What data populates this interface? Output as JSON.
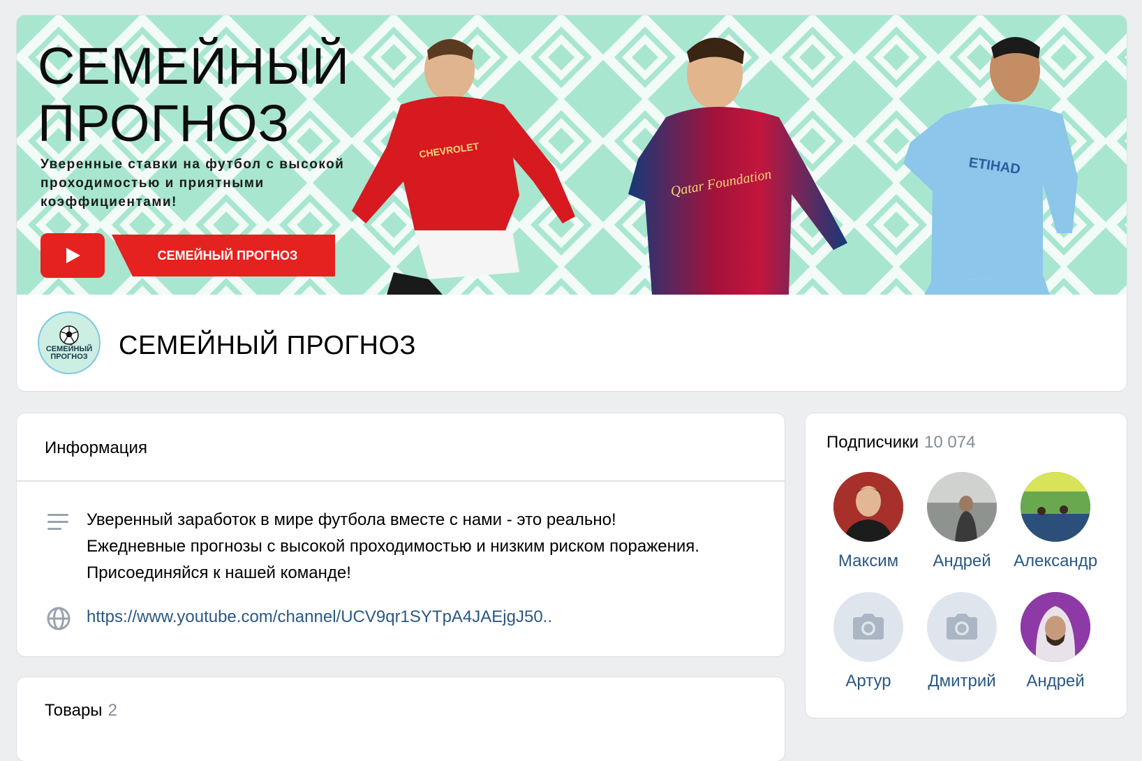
{
  "cover": {
    "title": "СЕМЕЙНЫЙ\nПРОГНОЗ",
    "subtitle": "Уверенные ставки на футбол с высокой проходимостью и приятными коэффициентами!",
    "banner_label": "СЕМЕЙНЫЙ ПРОГНОЗ",
    "players": [
      {
        "sponsor": "CHEVROLET"
      },
      {
        "sponsor": "Qatar Foundation"
      },
      {
        "sponsor": "ETIHAD"
      }
    ]
  },
  "group": {
    "name": "СЕМЕЙНЫЙ ПРОГНОЗ",
    "avatar_text": "СЕМЕЙНЫЙ ПРОГНОЗ"
  },
  "info": {
    "title": "Информация",
    "description": "Уверенный заработок в мире футбола вместе с нами - это реально! Ежедневные прогнозы с высокой проходимостью и низким риском поражения. Присоединяйся к нашей команде!",
    "link": "https://www.youtube.com/channel/UCV9qr1SYTpA4JAEjgJ50.."
  },
  "goods": {
    "title": "Товары",
    "count": "2"
  },
  "subscribers": {
    "title": "Подписчики",
    "count": "10 074",
    "members": [
      {
        "name": "Максим",
        "has_photo": true
      },
      {
        "name": "Андрей",
        "has_photo": true
      },
      {
        "name": "Александр",
        "has_photo": true
      },
      {
        "name": "Артур",
        "has_photo": false
      },
      {
        "name": "Дмитрий",
        "has_photo": false
      },
      {
        "name": "Андрей",
        "has_photo": true
      }
    ]
  },
  "colors": {
    "accent": "#2a5885",
    "youtube_red": "#e52220",
    "cover_bg": "#a8e6cf",
    "page_bg": "#edeef0"
  }
}
